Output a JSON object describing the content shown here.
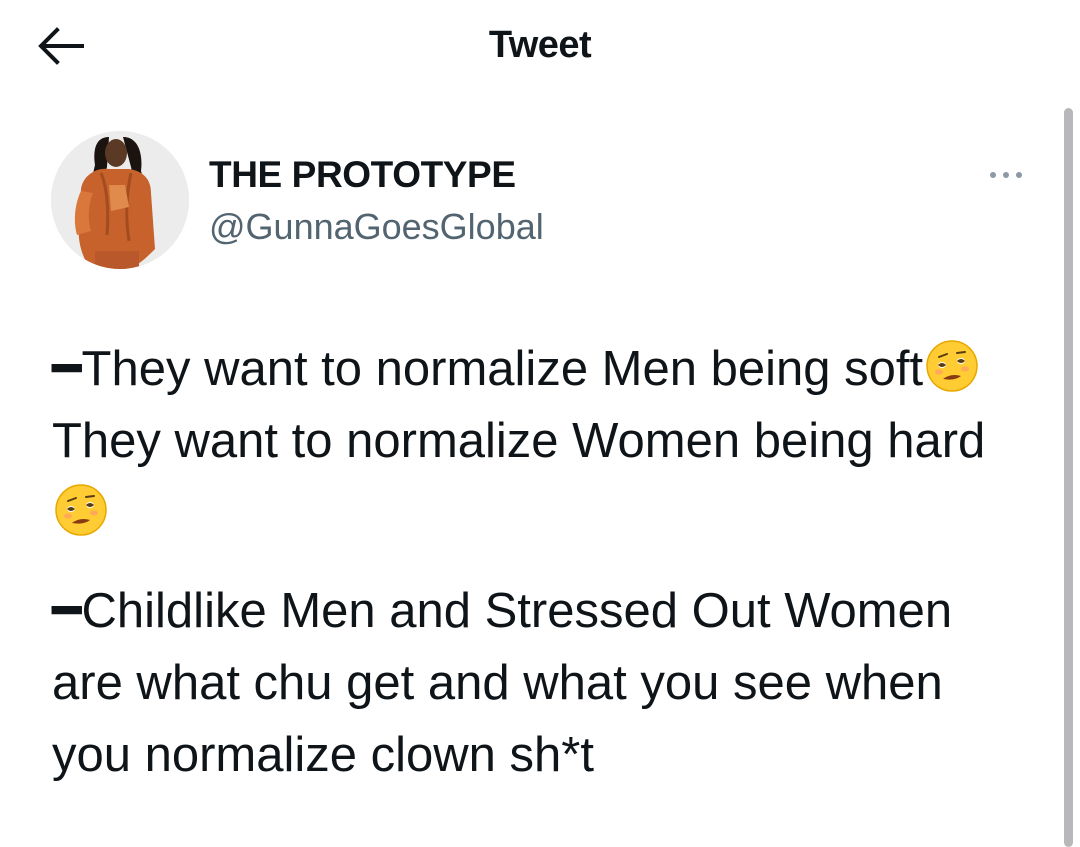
{
  "header": {
    "title": "Tweet",
    "back_icon": "arrow-left-icon"
  },
  "author": {
    "display_name": "THE PROTOTYPE",
    "handle": "@GunnaGoesGlobal",
    "avatar": "profile-photo"
  },
  "more_icon": "more-dots-icon",
  "tweet": {
    "paragraph1": {
      "dash": "━",
      "part1": "They want to normalize Men being soft",
      "part2": " They want to normalize Women being hard",
      "emoji": "woozy-face-emoji"
    },
    "paragraph2": {
      "dash": "━",
      "text": "Childlike Men and Stressed Out Women are what chu get and what you see when you normalize clown sh*t"
    }
  },
  "colors": {
    "text": "#0f1419",
    "secondary": "#536471",
    "scrollbar": "#b8b8bb"
  }
}
